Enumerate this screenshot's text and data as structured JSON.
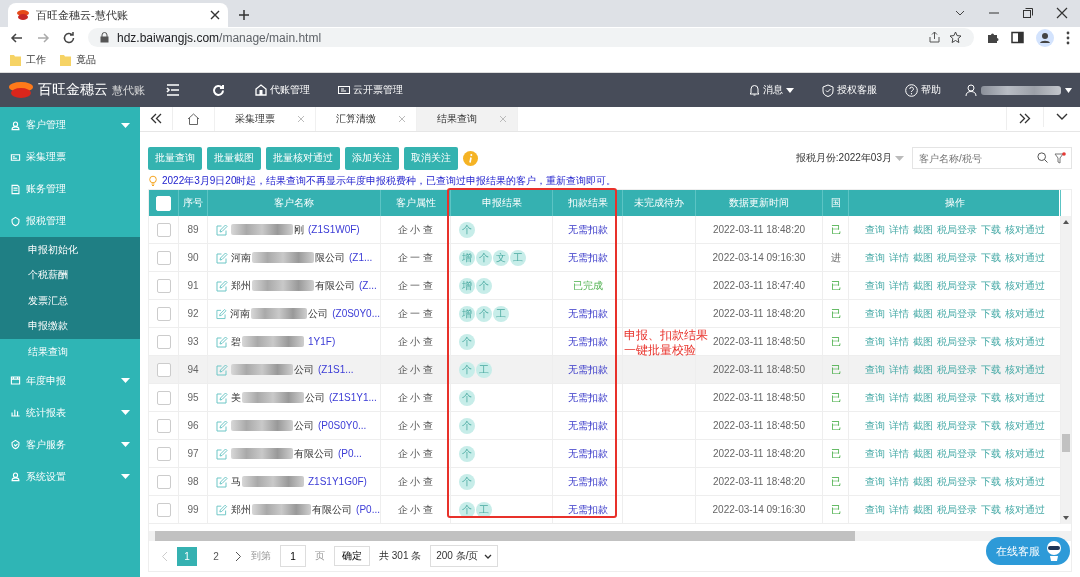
{
  "browser": {
    "tab_title": "百旺金穗云-慧代账",
    "url_host": "hdz.baiwangjs.com",
    "url_path": "/manage/main.html",
    "bookmarks": [
      "工作",
      "竟品"
    ]
  },
  "header": {
    "logo": "百旺金穗云",
    "product": "慧代账",
    "nav": [
      "代账管理",
      "云开票管理"
    ],
    "messages": "消息",
    "support": "授权客服",
    "help": "帮助"
  },
  "sidebar": {
    "items": [
      {
        "label": "客户管理",
        "kind": "group",
        "expanded": false
      },
      {
        "label": "采集理票",
        "kind": "link"
      },
      {
        "label": "账务管理",
        "kind": "link"
      },
      {
        "label": "报税管理",
        "kind": "group",
        "expanded": true,
        "children": [
          {
            "label": "申报初始化",
            "selected": false
          },
          {
            "label": "个税薪酬",
            "selected": false
          },
          {
            "label": "发票汇总",
            "selected": false
          },
          {
            "label": "申报缴款",
            "selected": false
          },
          {
            "label": "结果查询",
            "selected": true
          }
        ]
      },
      {
        "label": "年度申报",
        "kind": "group",
        "expanded": false
      },
      {
        "label": "统计报表",
        "kind": "group",
        "expanded": false
      },
      {
        "label": "客户服务",
        "kind": "group",
        "expanded": false
      },
      {
        "label": "系统设置",
        "kind": "group",
        "expanded": false
      }
    ]
  },
  "page_tabs": [
    {
      "label": "采集理票",
      "selected": false
    },
    {
      "label": "汇算清缴",
      "selected": false
    },
    {
      "label": "结果查询",
      "selected": true
    }
  ],
  "toolbar": {
    "buttons": [
      "批量查询",
      "批量截图",
      "批量核对通过",
      "添加关注",
      "取消关注"
    ],
    "month": "报税月份:2022年03月",
    "search": {
      "placeholder": "客户名称/税号"
    }
  },
  "notice": "2022年3月9日20时起，结果查询不再显示年度申报税费种，已查询过申报结果的客户，重新查询即可。",
  "table": {
    "header_checked": false,
    "columns": [
      "序号",
      "客户名称",
      "客户属性",
      "申报结果",
      "扣款结果",
      "未完成待办",
      "数据更新时间",
      "国",
      "操作"
    ],
    "rows": [
      {
        "no": "89",
        "checked": false,
        "highlighted": false,
        "name_end": "刚",
        "code": "(Z1S1W0F)",
        "attribute": "企 小 查",
        "report_tags": [
          "个"
        ],
        "deduction": {
          "text": "无需扣款",
          "kind": "waived"
        },
        "updated": "2022-03-11 18:48:20",
        "national_tax": {
          "text": "已",
          "kind": "done"
        },
        "actions": [
          "查询",
          "详情",
          "截图",
          "税局登录",
          "下载",
          "核对通过"
        ]
      },
      {
        "no": "90",
        "checked": false,
        "highlighted": false,
        "name_start": "河南",
        "name_end": "限公司",
        "code": "(Z1...",
        "attribute": "企 一 查",
        "report_tags": [
          "增",
          "个",
          "文",
          "工"
        ],
        "deduction": {
          "text": "无需扣款",
          "kind": "waived"
        },
        "updated": "2022-03-14 09:16:30",
        "national_tax": {
          "text": "进",
          "kind": "progress"
        },
        "actions": [
          "查询",
          "详情",
          "截图",
          "税局登录",
          "下载",
          "核对通过"
        ]
      },
      {
        "no": "91",
        "checked": false,
        "highlighted": false,
        "name_start": "郑州",
        "name_end": "有限公司",
        "code": "(Z...",
        "attribute": "企 一 查",
        "report_tags": [
          "增",
          "个"
        ],
        "deduction": {
          "text": "已完成",
          "kind": "done"
        },
        "updated": "2022-03-11 18:47:40",
        "national_tax": {
          "text": "已",
          "kind": "done"
        },
        "actions": [
          "查询",
          "详情",
          "截图",
          "税局登录",
          "下载",
          "核对通过"
        ]
      },
      {
        "no": "92",
        "checked": false,
        "highlighted": false,
        "name_start": "河南",
        "name_end": "公司",
        "code": "(Z0S0Y0...",
        "attribute": "企 一 查",
        "report_tags": [
          "增",
          "个",
          "工"
        ],
        "deduction": {
          "text": "无需扣款",
          "kind": "waived"
        },
        "updated": "2022-03-11 18:48:20",
        "national_tax": {
          "text": "已",
          "kind": "done"
        },
        "actions": [
          "查询",
          "详情",
          "截图",
          "税局登录",
          "下载",
          "核对通过"
        ]
      },
      {
        "no": "93",
        "checked": false,
        "highlighted": false,
        "name_start": "碧",
        "code": "1Y1F)",
        "attribute": "企 小 查",
        "report_tags": [
          "个"
        ],
        "deduction": {
          "text": "无需扣款",
          "kind": "waived"
        },
        "updated": "2022-03-11 18:48:50",
        "national_tax": {
          "text": "已",
          "kind": "done"
        },
        "actions": [
          "查询",
          "详情",
          "截图",
          "税局登录",
          "下载",
          "核对通过"
        ]
      },
      {
        "no": "94",
        "checked": false,
        "highlighted": true,
        "name_end": "公司",
        "code": "(Z1S1...",
        "attribute": "企 小 查",
        "report_tags": [
          "个",
          "工"
        ],
        "deduction": {
          "text": "无需扣款",
          "kind": "waived"
        },
        "updated": "2022-03-11 18:48:50",
        "national_tax": {
          "text": "已",
          "kind": "done"
        },
        "actions": [
          "查询",
          "详情",
          "截图",
          "税局登录",
          "下载",
          "核对通过"
        ]
      },
      {
        "no": "95",
        "checked": false,
        "highlighted": false,
        "name_start": "美",
        "name_end": "公司",
        "code": "(Z1S1Y1...",
        "attribute": "企 小 查",
        "report_tags": [
          "个"
        ],
        "deduction": {
          "text": "无需扣款",
          "kind": "waived"
        },
        "updated": "2022-03-11 18:48:50",
        "national_tax": {
          "text": "已",
          "kind": "done"
        },
        "actions": [
          "查询",
          "详情",
          "截图",
          "税局登录",
          "下载",
          "核对通过"
        ]
      },
      {
        "no": "96",
        "checked": false,
        "highlighted": false,
        "name_end": "公司",
        "code": "(P0S0Y0...",
        "attribute": "企 小 查",
        "report_tags": [
          "个"
        ],
        "deduction": {
          "text": "无需扣款",
          "kind": "waived"
        },
        "updated": "2022-03-11 18:48:50",
        "national_tax": {
          "text": "已",
          "kind": "done"
        },
        "actions": [
          "查询",
          "详情",
          "截图",
          "税局登录",
          "下载",
          "核对通过"
        ]
      },
      {
        "no": "97",
        "checked": false,
        "highlighted": false,
        "name_end": "有限公司",
        "code": "(P0...",
        "attribute": "企 小 查",
        "report_tags": [
          "个"
        ],
        "deduction": {
          "text": "无需扣款",
          "kind": "waived"
        },
        "updated": "2022-03-11 18:48:20",
        "national_tax": {
          "text": "已",
          "kind": "done"
        },
        "actions": [
          "查询",
          "详情",
          "截图",
          "税局登录",
          "下载",
          "核对通过"
        ]
      },
      {
        "no": "98",
        "checked": false,
        "highlighted": false,
        "name_start": "马",
        "code": "Z1S1Y1G0F)",
        "attribute": "企 小 查",
        "report_tags": [
          "个"
        ],
        "deduction": {
          "text": "无需扣款",
          "kind": "waived"
        },
        "updated": "2022-03-11 18:48:20",
        "national_tax": {
          "text": "已",
          "kind": "done"
        },
        "actions": [
          "查询",
          "详情",
          "截图",
          "税局登录",
          "下载",
          "核对通过"
        ]
      },
      {
        "no": "99",
        "checked": false,
        "highlighted": false,
        "name_start": "郑州",
        "name_end": "有限公司",
        "code": "(P0...",
        "attribute": "企 小 查",
        "report_tags": [
          "个",
          "工"
        ],
        "deduction": {
          "text": "无需扣款",
          "kind": "waived"
        },
        "updated": "2022-03-14 09:16:30",
        "national_tax": {
          "text": "已",
          "kind": "done"
        },
        "actions": [
          "查询",
          "详情",
          "截图",
          "税局登录",
          "下载",
          "核对通过"
        ]
      }
    ]
  },
  "pagination": {
    "pages": [
      {
        "label": "1",
        "selected": true
      },
      {
        "label": "2",
        "selected": false
      }
    ],
    "goto_label": "到第",
    "goto_value": "1",
    "page_unit": "页",
    "confirm": "确定",
    "total": "共 301 条",
    "page_size": "200 条/页"
  },
  "chat_button": "在线客服",
  "annotation": "申报、扣款结果一键批量校验"
}
